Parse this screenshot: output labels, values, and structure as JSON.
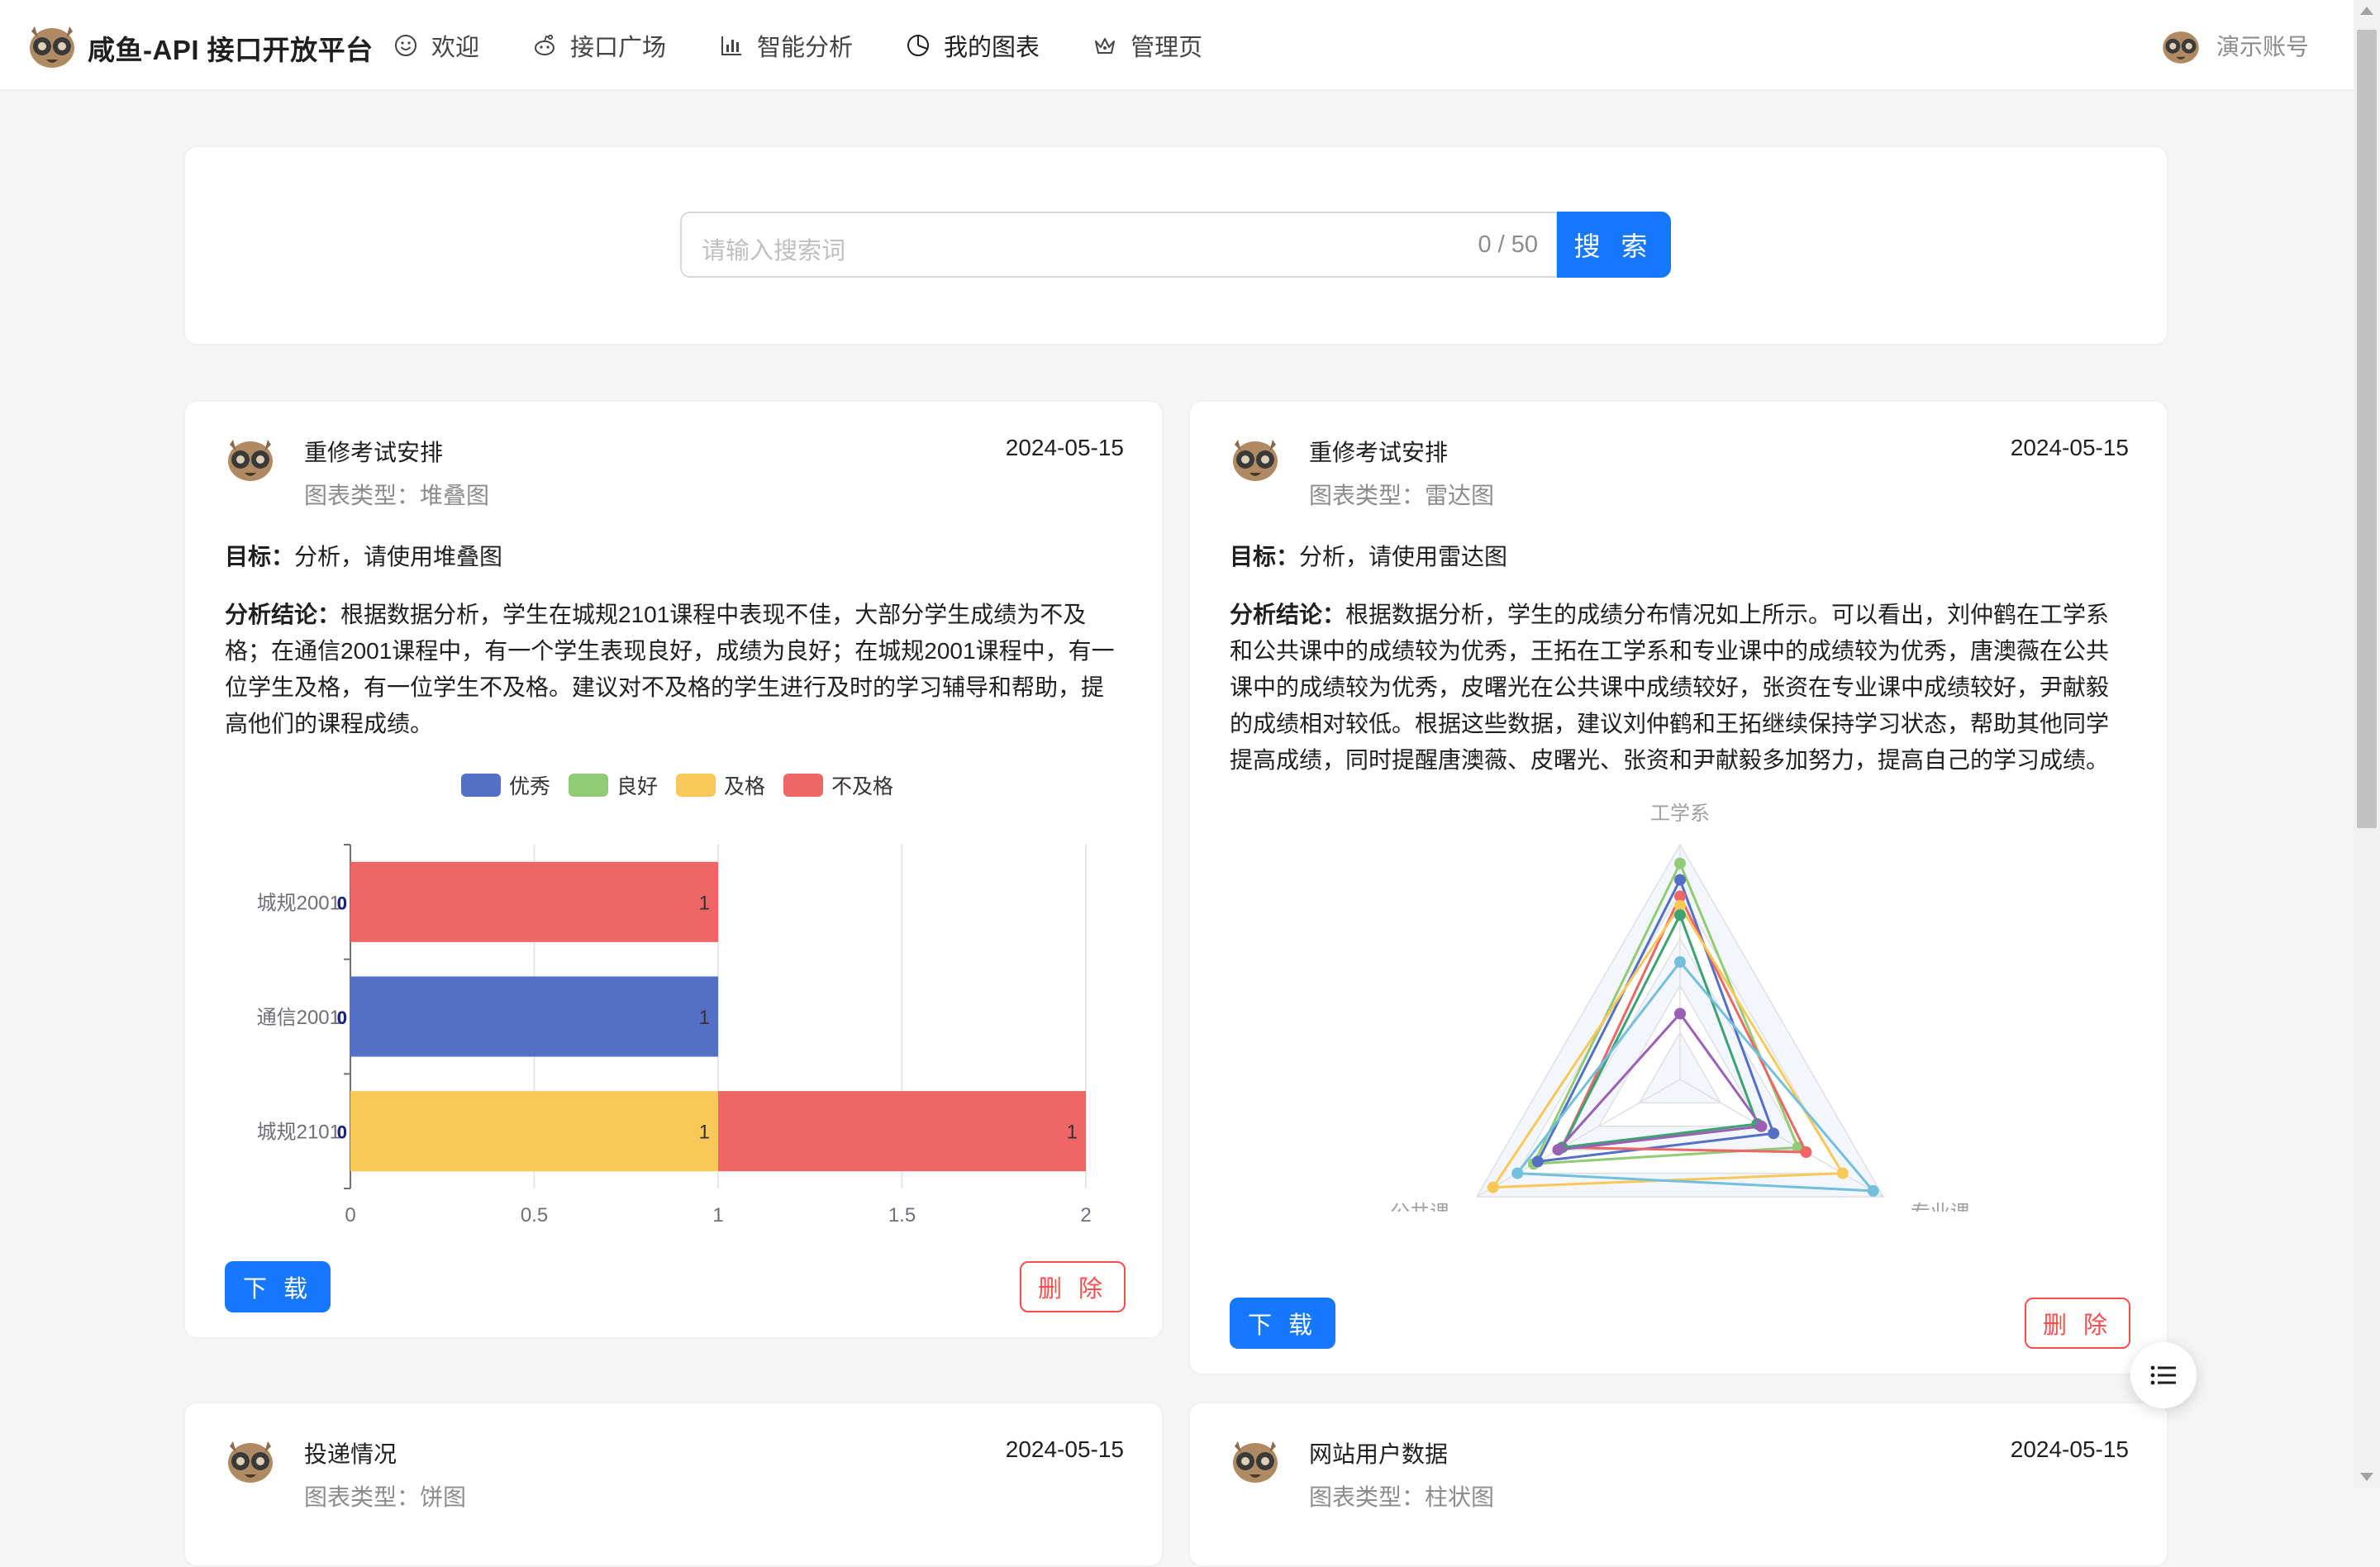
{
  "header": {
    "brand": "咸鱼-API 接口开放平台",
    "nav": [
      {
        "label": "欢迎",
        "icon": "smile-icon"
      },
      {
        "label": "接口广场",
        "icon": "reddit-icon"
      },
      {
        "label": "智能分析",
        "icon": "bar-chart-icon"
      },
      {
        "label": "我的图表",
        "icon": "pie-chart-icon"
      },
      {
        "label": "管理页",
        "icon": "crown-icon"
      }
    ],
    "account": "演示账号"
  },
  "search": {
    "placeholder": "请输入搜索词",
    "count": "0 / 50",
    "button": "搜 索"
  },
  "cards": [
    {
      "title": "重修考试安排",
      "chart_type": "图表类型：堆叠图",
      "date": "2024-05-15",
      "goal_label": "目标：",
      "goal": "分析，请使用堆叠图",
      "conclusion_label": "分析结论：",
      "conclusion": "根据数据分析，学生在城规2101课程中表现不佳，大部分学生成绩为不及格；在通信2001课程中，有一个学生表现良好，成绩为良好；在城规2001课程中，有一位学生及格，有一位学生不及格。建议对不及格的学生进行及时的学习辅导和帮助，提高他们的课程成绩。",
      "download": "下 载",
      "delete": "删 除"
    },
    {
      "title": "重修考试安排",
      "chart_type": "图表类型：雷达图",
      "date": "2024-05-15",
      "goal_label": "目标：",
      "goal": "分析，请使用雷达图",
      "conclusion_label": "分析结论：",
      "conclusion": "根据数据分析，学生的成绩分布情况如上所示。可以看出，刘仲鹤在工学系和公共课中的成绩较为优秀，王拓在工学系和专业课中的成绩较为优秀，唐澳薇在公共课中的成绩较为优秀，皮曙光在公共课中成绩较好，张资在专业课中成绩较好，尹献毅的成绩相对较低。根据这些数据，建议刘仲鹤和王拓继续保持学习状态，帮助其他同学提高成绩，同时提醒唐澳薇、皮曙光、张资和尹献毅多加努力，提高自己的学习成绩。",
      "download": "下 载",
      "delete": "删 除"
    },
    {
      "title": "投递情况",
      "chart_type": "图表类型：饼图",
      "date": "2024-05-15"
    },
    {
      "title": "网站用户数据",
      "chart_type": "图表类型：柱状图",
      "date": "2024-05-15"
    }
  ],
  "chart_data": [
    {
      "type": "bar",
      "orientation": "horizontal",
      "stacked": true,
      "categories": [
        "城规2101",
        "通信2001",
        "城规2001"
      ],
      "series": [
        {
          "name": "优秀",
          "color": "#5470c6",
          "values": [
            0,
            1,
            0
          ]
        },
        {
          "name": "良好",
          "color": "#91cc75",
          "values": [
            0,
            0,
            0
          ]
        },
        {
          "name": "及格",
          "color": "#fac858",
          "values": [
            1,
            0,
            0
          ]
        },
        {
          "name": "不及格",
          "color": "#ee6666",
          "values": [
            1,
            0,
            1
          ]
        }
      ],
      "value_labels": [
        [
          "1",
          "1"
        ],
        [
          "0"
        ],
        [
          "1"
        ]
      ],
      "xlim": [
        0,
        2
      ],
      "xticks": [
        "0",
        "0.5",
        "1",
        "1.5",
        "2"
      ],
      "legend": "top-center"
    },
    {
      "type": "radar",
      "indicators": [
        "工学系",
        "专业课",
        "公共课"
      ],
      "max": 100,
      "series": [
        {
          "color": "#91cc75",
          "values": [
            92,
            58,
            72
          ]
        },
        {
          "color": "#5470c6",
          "values": [
            85,
            46,
            70
          ]
        },
        {
          "color": "#ee6666",
          "values": [
            78,
            62,
            58
          ]
        },
        {
          "color": "#fac858",
          "values": [
            74,
            80,
            92
          ]
        },
        {
          "color": "#3ba272",
          "values": [
            70,
            38,
            58
          ]
        },
        {
          "color": "#73c0de",
          "values": [
            50,
            95,
            80
          ]
        },
        {
          "color": "#9a60b4",
          "values": [
            28,
            40,
            60
          ]
        }
      ]
    }
  ]
}
